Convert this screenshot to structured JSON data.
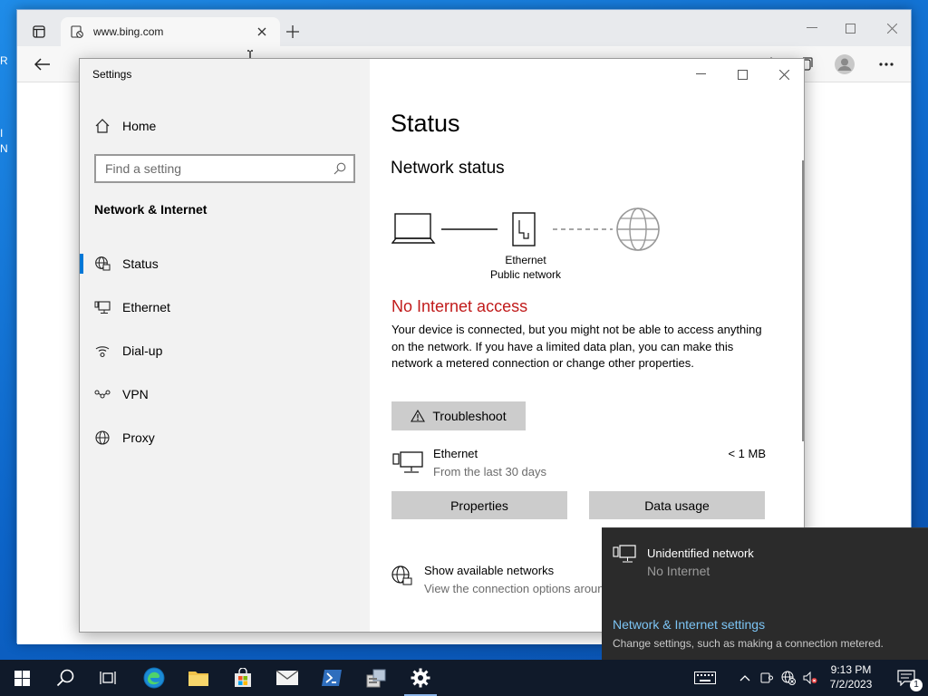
{
  "desktop": {
    "fragments": [
      "R",
      "I",
      "N"
    ]
  },
  "browser": {
    "tab_title": "www.bing.com"
  },
  "settings": {
    "window_title": "Settings",
    "home_label": "Home",
    "search_placeholder": "Find a setting",
    "section_heading": "Network & Internet",
    "nav": [
      {
        "label": "Status",
        "icon": "status-globe-icon",
        "selected": true
      },
      {
        "label": "Ethernet",
        "icon": "ethernet-icon"
      },
      {
        "label": "Dial-up",
        "icon": "dial-up-icon"
      },
      {
        "label": "VPN",
        "icon": "vpn-icon"
      },
      {
        "label": "Proxy",
        "icon": "proxy-globe-icon"
      }
    ],
    "main": {
      "page_title": "Status",
      "section_title": "Network status",
      "diagram_label_line1": "Ethernet",
      "diagram_label_line2": "Public network",
      "alert": "No Internet access",
      "alert_color": "#c11b1b",
      "description": "Your device is connected, but you might not be able to access anything on the network. If you have a limited data plan, you can make this network a metered connection or change other properties.",
      "troubleshoot_label": "Troubleshoot",
      "connection_name": "Ethernet",
      "connection_period": "From the last 30 days",
      "connection_usage": "< 1 MB",
      "properties_label": "Properties",
      "data_usage_label": "Data usage",
      "show_networks_title": "Show available networks",
      "show_networks_sub": "View the connection options around you."
    }
  },
  "flyout": {
    "network_name": "Unidentified network",
    "network_status": "No Internet",
    "settings_link": "Network & Internet settings",
    "settings_sub": "Change settings, such as making a connection metered.",
    "link_color": "#7cc4f4"
  },
  "taskbar": {
    "time": "9:13 PM",
    "date": "7/2/2023",
    "notification_count": "1"
  }
}
